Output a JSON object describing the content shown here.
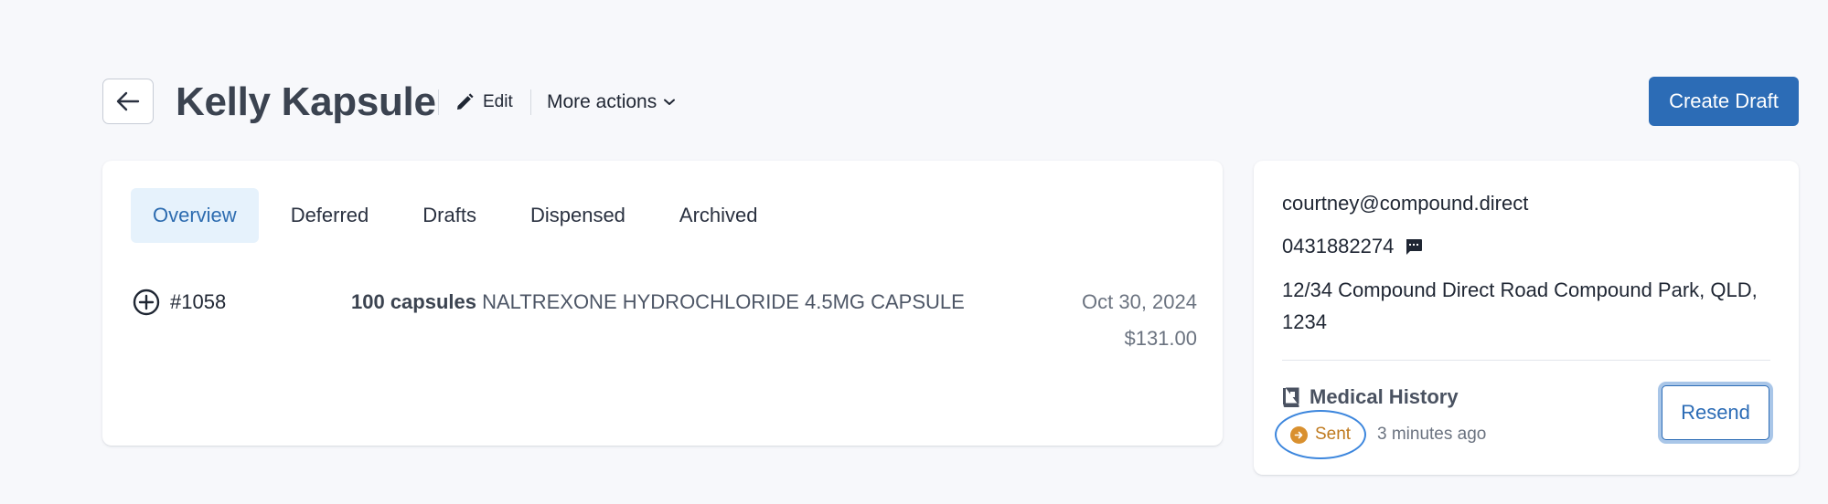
{
  "header": {
    "title": "Kelly Kapsule",
    "edit_label": "Edit",
    "more_actions_label": "More actions",
    "create_draft_label": "Create Draft"
  },
  "tabs": [
    {
      "label": "Overview",
      "active": true
    },
    {
      "label": "Deferred",
      "active": false
    },
    {
      "label": "Drafts",
      "active": false
    },
    {
      "label": "Dispensed",
      "active": false
    },
    {
      "label": "Archived",
      "active": false
    }
  ],
  "orders": [
    {
      "id": "#1058",
      "quantity": "100 capsules",
      "product": "NALTREXONE HYDROCHLORIDE 4.5MG CAPSULE",
      "date": "Oct 30, 2024",
      "price": "$131.00"
    }
  ],
  "contact": {
    "email": "courtney@compound.direct",
    "phone": "0431882274",
    "address": "12/34 Compound Direct Road Compound Park, QLD, 1234"
  },
  "medical_history": {
    "title": "Medical History",
    "status": "Sent",
    "time_ago": "3 minutes ago",
    "resend_label": "Resend"
  },
  "colors": {
    "primary": "#2c6cb6",
    "active_tab_bg": "#e6f2fc",
    "status_sent": "#d9902f",
    "highlight_circle": "#3c86dd"
  },
  "icons": {
    "back": "arrow-left-icon",
    "edit": "pencil-icon",
    "more": "chevron-down-icon",
    "expand": "plus-circle-icon",
    "message": "message-icon",
    "medical": "book-icon",
    "status": "arrow-right-icon"
  }
}
